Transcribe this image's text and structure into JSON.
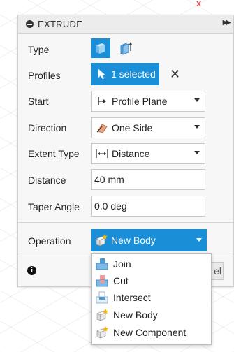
{
  "panel": {
    "title": "EXTRUDE",
    "rows": {
      "type_label": "Type",
      "profiles_label": "Profiles",
      "profiles_value": "1 selected",
      "start_label": "Start",
      "start_value": "Profile Plane",
      "direction_label": "Direction",
      "direction_value": "One Side",
      "extent_label": "Extent Type",
      "extent_value": "Distance",
      "distance_label": "Distance",
      "distance_value": "40 mm",
      "taper_label": "Taper Angle",
      "taper_value": "0.0 deg",
      "operation_label": "Operation",
      "operation_value": "New Body"
    },
    "cancel_label_partial": "el"
  },
  "dropdown": {
    "options": [
      {
        "label": "Join",
        "icon": "join-icon"
      },
      {
        "label": "Cut",
        "icon": "cut-icon"
      },
      {
        "label": "Intersect",
        "icon": "intersect-icon"
      },
      {
        "label": "New Body",
        "icon": "new-body-icon"
      },
      {
        "label": "New Component",
        "icon": "new-component-icon"
      }
    ]
  },
  "colors": {
    "accent": "#1a8fd8",
    "panel_bg": "#f7f7f7",
    "header_bg": "#ececec"
  }
}
